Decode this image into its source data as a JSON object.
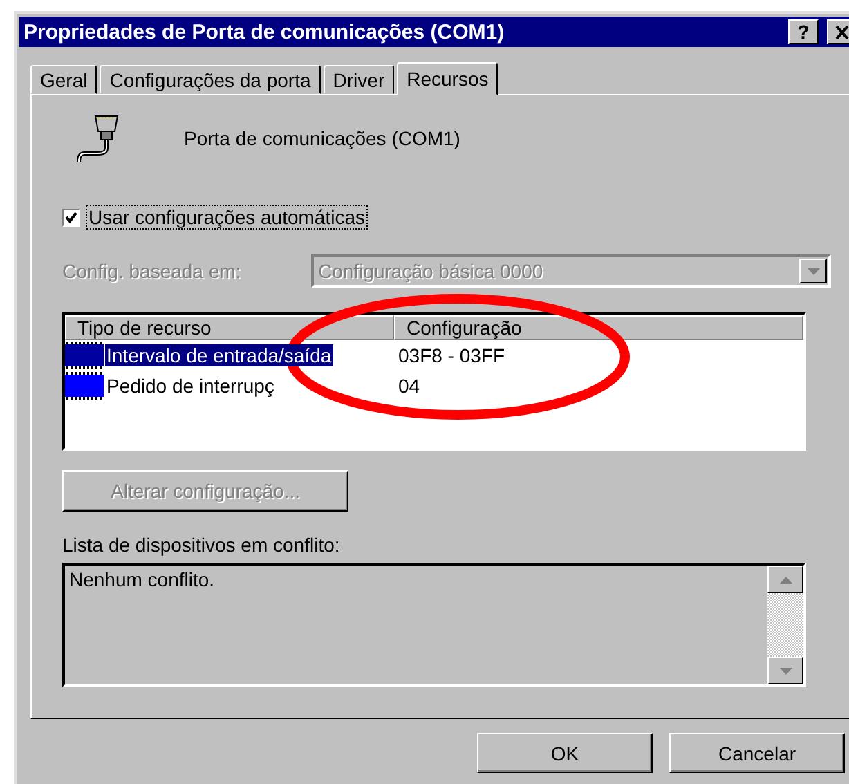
{
  "window": {
    "title": "Propriedades de Porta de comunicações (COM1)",
    "help_button": "?"
  },
  "tabs": [
    {
      "label": "Geral",
      "selected": false
    },
    {
      "label": "Configurações da porta",
      "selected": false
    },
    {
      "label": "Driver",
      "selected": false
    },
    {
      "label": "Recursos",
      "selected": true
    }
  ],
  "device": {
    "name": "Porta de comunicações (COM1)"
  },
  "auto_settings": {
    "label": "Usar configurações automáticas",
    "checked": true
  },
  "based_on": {
    "label": "Config. baseada em:",
    "value": "Configuração básica 0000",
    "disabled": true
  },
  "resources": {
    "columns": [
      "Tipo de recurso",
      "Configuração"
    ],
    "rows": [
      {
        "type": "Intervalo de entrada/saída",
        "setting": "03F8 - 03FF",
        "selected": true
      },
      {
        "type": "Pedido de interrupç",
        "setting": "04",
        "selected": false
      }
    ]
  },
  "change_button": {
    "label": "Alterar configuração...",
    "disabled": true
  },
  "conflicts": {
    "label": "Lista de dispositivos em conflito:",
    "text": "Nenhum conflito."
  },
  "buttons": [
    "OK",
    "Cancelar"
  ],
  "annotation": {
    "kind": "ellipse"
  }
}
